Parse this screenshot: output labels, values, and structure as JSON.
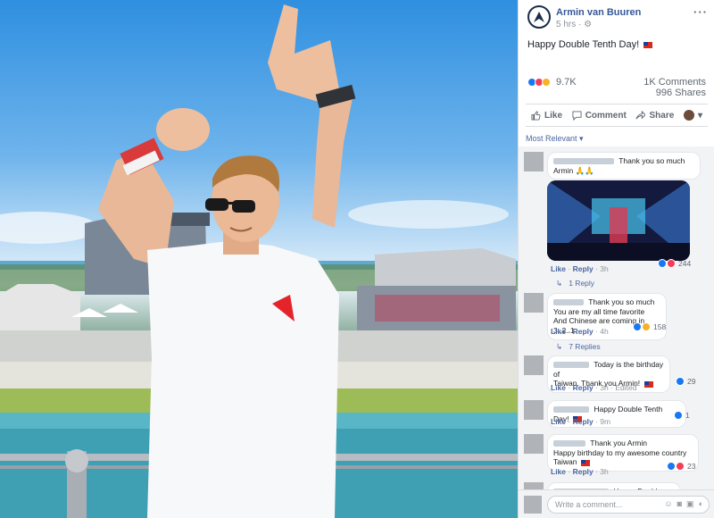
{
  "post": {
    "author": "Armin van Buuren",
    "time": "5 hrs",
    "privacy_icon": "gear-icon",
    "text": "Happy Double Tenth Day!",
    "reaction_count": "9.7K",
    "comments_count": "1K Comments",
    "shares_count": "996 Shares"
  },
  "actions": {
    "like": "Like",
    "comment": "Comment",
    "share": "Share"
  },
  "sort_label": "Most Relevant",
  "comments": [
    {
      "text_line1": "Thank you so much",
      "text_line2": "Armin 🙏🙏",
      "like": "Like",
      "reply": "Reply",
      "time": "3h",
      "count": "244",
      "replies": "1 Reply"
    },
    {
      "text_line1": "Thank you so much",
      "text_line2": "You are my all time favorite",
      "text_line3": "And Chinese are coming in 3..2..1",
      "like": "Like",
      "reply": "Reply",
      "time": "4h",
      "count": "158",
      "replies": "7 Replies"
    },
    {
      "text_line1": "Today is the birthday of",
      "text_line2": "Taiwan. Thank you Armin!",
      "like": "Like",
      "reply": "Reply",
      "time": "3h",
      "edited": "Edited",
      "count": "29"
    },
    {
      "text_line1": "Happy Double Tenth Day!",
      "like": "Like",
      "reply": "Reply",
      "time": "9m",
      "count": "1"
    },
    {
      "text_line1": "Thank you Armin",
      "text_line2": "Happy birthday to my awesome country",
      "text_line3": "Taiwan",
      "like": "Like",
      "reply": "Reply",
      "time": "3h",
      "count": "23"
    },
    {
      "text_line1": "Happy Double Tenth"
    }
  ],
  "write_comment": {
    "placeholder": "Write a comment..."
  },
  "colors": {
    "link_blue": "#365899",
    "like_blue": "#1877f2",
    "love_red": "#f33e58",
    "wow_yellow": "#f7b125",
    "flag_red": "#d52b1e",
    "flag_blue": "#1c3f94"
  }
}
